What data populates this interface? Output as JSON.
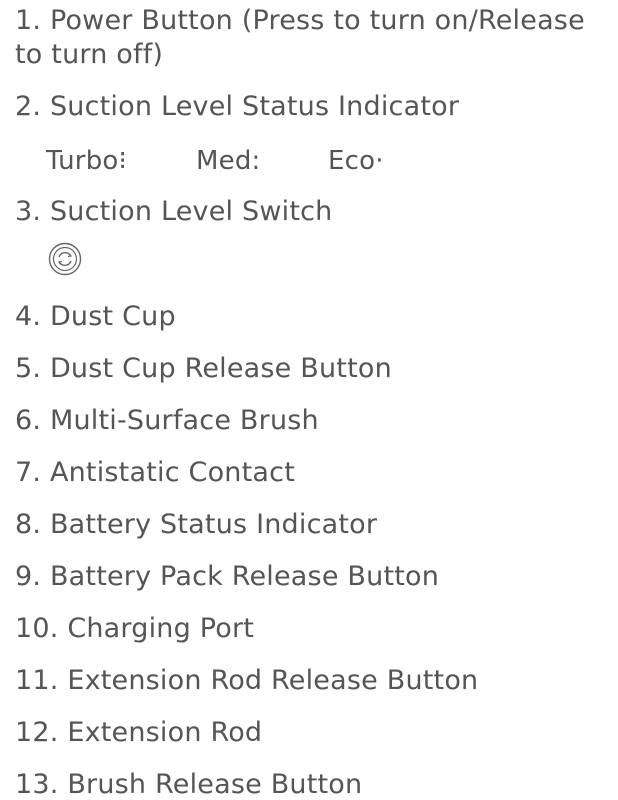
{
  "items": [
    {
      "label": "1. Power Button (Press to turn on/Release to turn off)"
    },
    {
      "label": "2. Suction Level Status Indicator"
    },
    {
      "label": "3. Suction Level Switch"
    },
    {
      "label": "4. Dust Cup"
    },
    {
      "label": "5. Dust Cup Release Button"
    },
    {
      "label": "6. Multi-Surface Brush"
    },
    {
      "label": "7. Antistatic Contact"
    },
    {
      "label": "8. Battery Status Indicator"
    },
    {
      "label": "9. Battery Pack Release Button"
    },
    {
      "label": "10. Charging Port"
    },
    {
      "label": "11. Extension Rod Release Button"
    },
    {
      "label": "12. Extension Rod"
    },
    {
      "label": "13. Brush Release Button"
    }
  ],
  "suction_levels": {
    "turbo": "Turbo⁝",
    "med": "Med:",
    "eco": "Eco·"
  },
  "switch_icon": "suction-switch-icon",
  "colors": {
    "text": "#555555"
  }
}
